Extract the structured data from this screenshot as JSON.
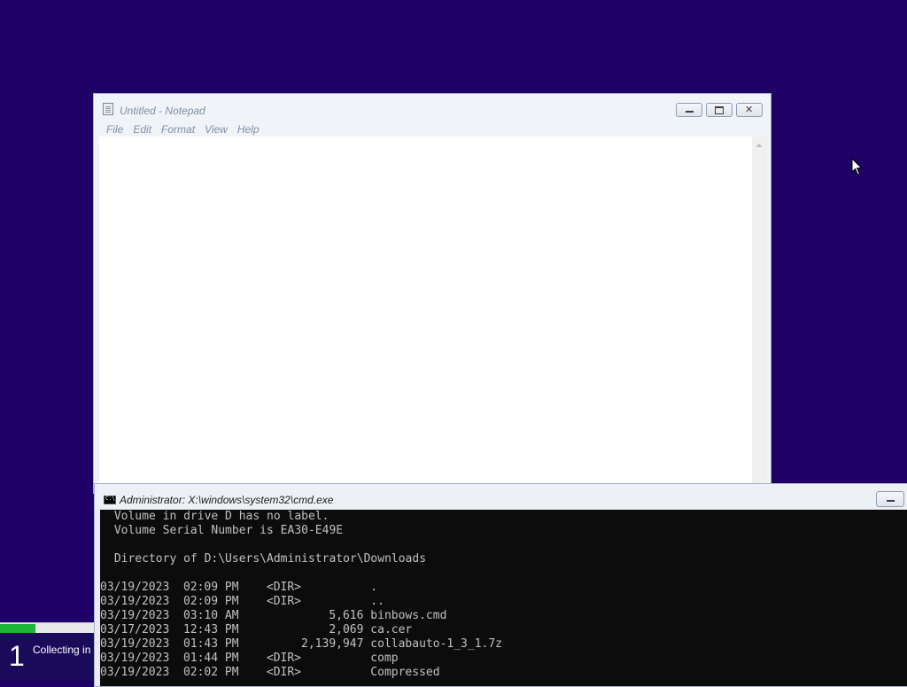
{
  "setup": {
    "step_number": "1",
    "step_label": "Collecting in",
    "progress_fraction": 0.38,
    "progress_color": "#1fb53a"
  },
  "notepad": {
    "title": "Untitled - Notepad",
    "menu": [
      "File",
      "Edit",
      "Format",
      "View",
      "Help"
    ],
    "content": ""
  },
  "cmd": {
    "title": "Administrator: X:\\windows\\system32\\cmd.exe",
    "header_lines": [
      " Volume in drive D has no label.",
      " Volume Serial Number is EA30-E49E",
      "",
      " Directory of D:\\Users\\Administrator\\Downloads",
      ""
    ],
    "entries": [
      {
        "date": "03/19/2023",
        "time": "02:09 PM",
        "size": "<DIR>",
        "name": "."
      },
      {
        "date": "03/19/2023",
        "time": "02:09 PM",
        "size": "<DIR>",
        "name": ".."
      },
      {
        "date": "03/19/2023",
        "time": "03:10 AM",
        "size": "5,616",
        "name": "binbows.cmd"
      },
      {
        "date": "03/17/2023",
        "time": "12:43 PM",
        "size": "2,069",
        "name": "ca.cer"
      },
      {
        "date": "03/19/2023",
        "time": "01:43 PM",
        "size": "2,139,947",
        "name": "collabauto-1_3_1.7z"
      },
      {
        "date": "03/19/2023",
        "time": "01:44 PM",
        "size": "<DIR>",
        "name": "comp"
      },
      {
        "date": "03/19/2023",
        "time": "02:02 PM",
        "size": "<DIR>",
        "name": "Compressed"
      }
    ]
  }
}
